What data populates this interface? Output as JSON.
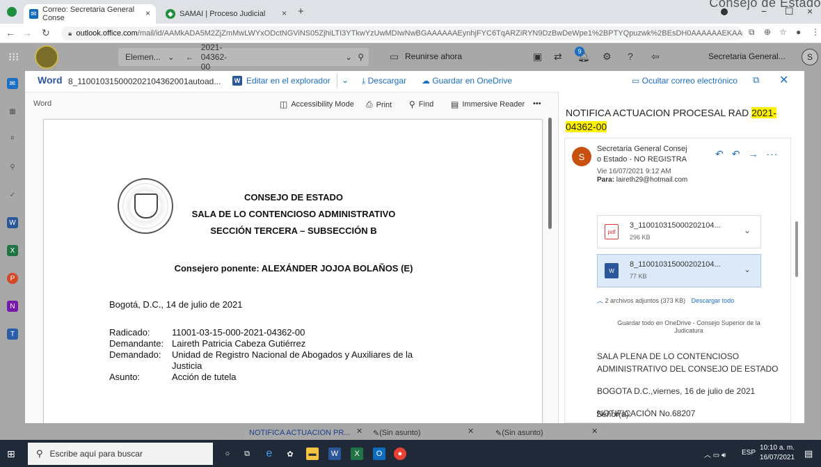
{
  "browser": {
    "corner_title": "Consejo de Estado",
    "tabs": [
      {
        "label": "Correo: Secretaria General Conse",
        "close": "×"
      },
      {
        "label": "SAMAI | Proceso Judicial",
        "close": "×"
      }
    ],
    "new_tab": "+",
    "url_host": "outlook.office.com",
    "url_path": "/mail/id/AAMkADA5M2ZjZmMwLWYxODctNGViNS05ZjhiLTI3YTkwYzUwMDIwNwBGAAAAAAEynhjFYC6TqARZiRYN9DzBwDeWpe1%2BPTYQpuzwk%2BEsDH0AAAAAAEKAADe..."
  },
  "outlook": {
    "search_scope": "Elemen...",
    "search_value": "2021-04362-00",
    "meet_now": "Reunirse ahora",
    "notification_count": "9",
    "user_name": "Secretaria General...",
    "avatar_initial": "S"
  },
  "preview": {
    "app_label": "Word",
    "file_name": "8_110010315000202104362001autoad...",
    "edit_in_browser": "Editar en el explorador",
    "download": "Descargar",
    "save_onedrive": "Guardar en OneDrive",
    "hide_mail": "Ocultar correo electrónico"
  },
  "viewer": {
    "label": "Word",
    "tools": [
      "Accessibility Mode",
      "Print",
      "Find",
      "Immersive Reader"
    ],
    "more": "•••"
  },
  "document": {
    "heading1": "CONSEJO DE ESTADO",
    "heading2": "SALA DE LO CONTENCIOSO ADMINISTRATIVO",
    "heading3": "SECCIÓN TERCERA – SUBSECCIÓN B",
    "ponente": "Consejero ponente: ALEXÁNDER JOJOA BOLAÑOS (E)",
    "date_line": "Bogotá, D.C., 14 de julio de 2021",
    "fields": [
      {
        "label": "Radicado:",
        "value": "11001-03-15-000-2021-04362-00"
      },
      {
        "label": "Demandante:",
        "value": "Laireth Patricia Cabeza Gutiérrez"
      },
      {
        "label": "Demandado:",
        "value": "Unidad de Registro Nacional de Abogados y Auxiliares de la"
      },
      {
        "label": "",
        "value": "Justicia"
      },
      {
        "label": "Asunto:",
        "value": "Acción de tutela"
      }
    ]
  },
  "email": {
    "subject_prefix": "NOTIFICA ACTUACION PROCESAL RAD ",
    "subject_highlight": "2021-04362-00",
    "sender_initial": "S",
    "sender_line1": "Secretaria General Consej",
    "sender_line2": "o Estado - NO REGISTRA",
    "date": "Vie 16/07/2021 9:12 AM",
    "to_label": "Para:",
    "to_value": "laireth29@hotmail.com",
    "attachments": [
      {
        "name": "3_110010315000202104...",
        "size": "296 KB",
        "type": "pdf"
      },
      {
        "name": "8_110010315000202104...",
        "size": "77 KB",
        "type": "word"
      }
    ],
    "attachments_summary": "2 archivos adjuntos (373 KB)",
    "download_all": "Descargar todo",
    "save_all_line1": "Guardar todo en OneDrive - Consejo Superior de la",
    "save_all_line2": "Judicatura",
    "body": [
      "SALA PLENA DE LO CONTENCIOSO",
      "ADMINISTRATIVO DEL CONSEJO DE ESTADO",
      "BOGOTA D.C.,viernes, 16 de julio de 2021",
      "NOTIFICACIÓN No.68207",
      "Señor(a):"
    ]
  },
  "bottom_tabs": [
    {
      "label": "NOTIFICA ACTUACION PR..."
    },
    {
      "label": "(Sin asunto)"
    },
    {
      "label": "(Sin asunto)"
    }
  ],
  "taskbar": {
    "search_placeholder": "Escribe aquí para buscar",
    "lang": "ESP",
    "time": "10:10 a. m.",
    "date": "16/07/2021"
  }
}
